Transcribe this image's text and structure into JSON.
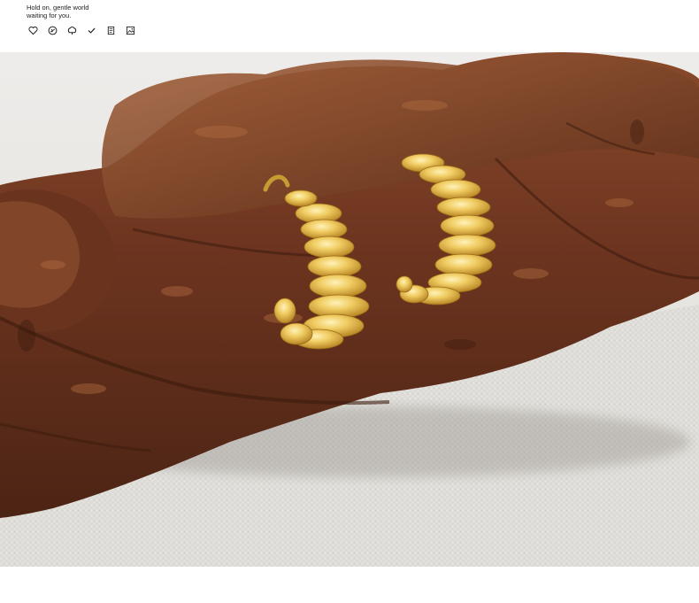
{
  "header": {
    "tagline_line1": "Hold on, gentle world",
    "tagline_line2": "waiting for you.",
    "icons": [
      "heart-icon",
      "no-fading-icon",
      "hypoallergenic-icon",
      "checkmark-icon",
      "certificate-icon",
      "image-icon"
    ]
  },
  "photo": {
    "subject": "gold-ribbed-c-hoop-earrings",
    "colors": {
      "background": "#e9e7e2",
      "fabric": "#dcdad5",
      "wood_dark": "#4a2414",
      "wood_mid": "#7a3e22",
      "wood_light": "#9c5a36",
      "gold": "#d9a93a",
      "gold_light": "#f5d77a",
      "gold_dark": "#a8761a"
    }
  }
}
